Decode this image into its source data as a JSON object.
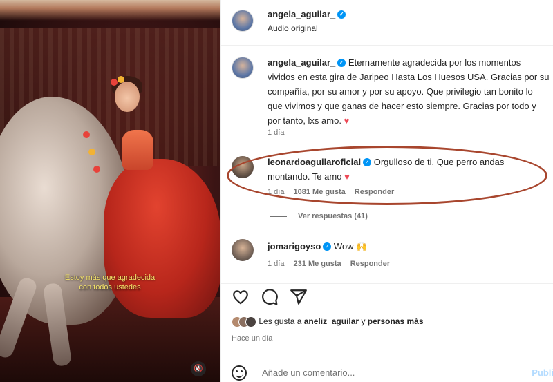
{
  "media": {
    "subtitle_line1": "Estoy más que agradecida",
    "subtitle_line2": "con todos ustedes",
    "mute_icon": "mute-icon"
  },
  "header": {
    "username": "angela_aguilar_",
    "audio": "Audio original"
  },
  "caption": {
    "username": "angela_aguilar_",
    "text": "Eternamente agradecida por los momentos vividos en esta gira de Jaripeo Hasta Los Huesos USA. Gracias por su compañía, por su amor y por su apoyo. Que privilegio tan bonito lo que vivimos y que ganas de hacer esto siempre. Gracias por todo y por tanto, lxs amo.",
    "emoji": "♥",
    "time": "1 día"
  },
  "comments": [
    {
      "username": "leonardoaguilaroficial",
      "text": "Orgulloso de ti. Que perro andas montando. Te amo",
      "emoji": "♥",
      "time": "1 día",
      "likes": "1081 Me gusta",
      "reply": "Responder"
    },
    {
      "username": "jomarigoyso",
      "text": "Wow",
      "emoji": "🙌",
      "time": "1 día",
      "likes": "231 Me gusta",
      "reply": "Responder"
    }
  ],
  "view_replies": "Ver respuestas (41)",
  "actions": {
    "like_icon": "heart-icon",
    "comment_icon": "comment-icon",
    "share_icon": "send-icon"
  },
  "likes": {
    "prefix": "Les gusta a",
    "user": "aneliz_aguilar",
    "middle": "y",
    "suffix": "personas más"
  },
  "post_date": "Hace un día",
  "add_comment": {
    "placeholder": "Añade un comentario...",
    "publish": "Publi"
  },
  "colors": {
    "verified": "#0095f6",
    "highlight_ellipse": "#a8462e",
    "heart": "#ed4956"
  }
}
